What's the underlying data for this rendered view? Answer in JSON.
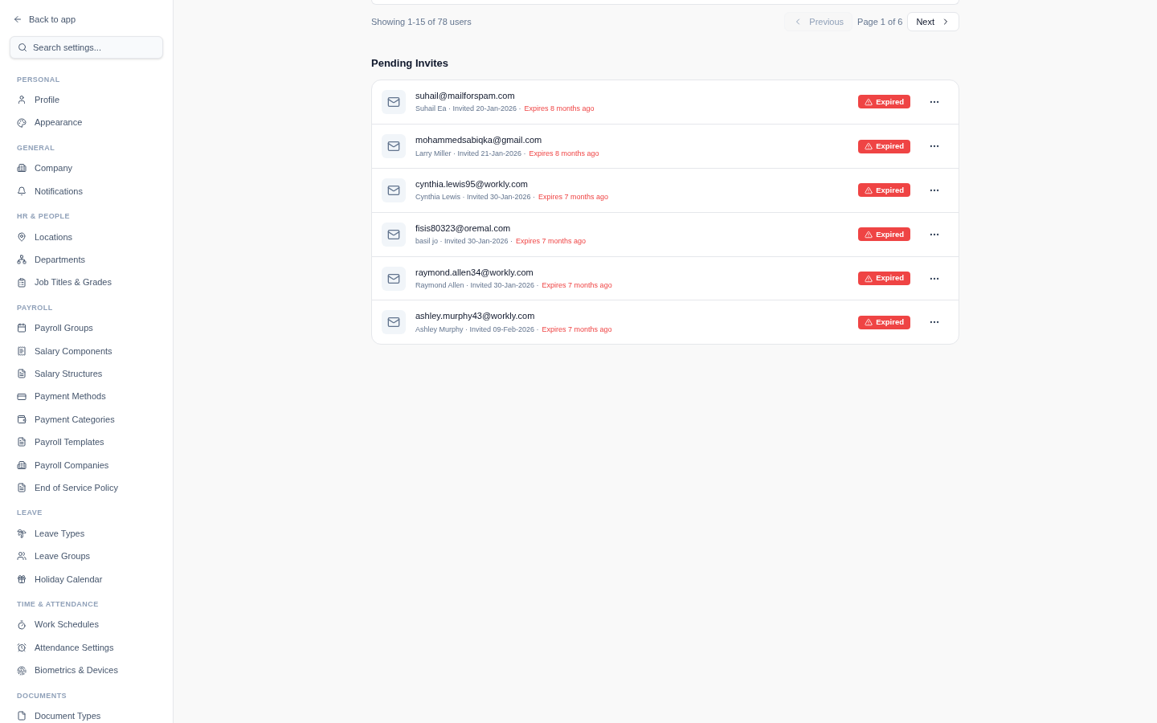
{
  "sidebar": {
    "back_link": "Back to app",
    "search": {
      "placeholder": "Search settings..."
    },
    "sections": [
      {
        "title": "PERSONAL",
        "items": [
          {
            "label": "Profile"
          },
          {
            "label": "Appearance"
          }
        ]
      },
      {
        "title": "GENERAL",
        "items": [
          {
            "label": "Company"
          },
          {
            "label": "Notifications"
          }
        ]
      },
      {
        "title": "HR & PEOPLE",
        "items": [
          {
            "label": "Locations"
          },
          {
            "label": "Departments"
          },
          {
            "label": "Job Titles & Grades"
          }
        ]
      },
      {
        "title": "PAYROLL",
        "items": [
          {
            "label": "Payroll Groups"
          },
          {
            "label": "Salary Components"
          },
          {
            "label": "Salary Structures"
          },
          {
            "label": "Payment Methods"
          },
          {
            "label": "Payment Categories"
          },
          {
            "label": "Payroll Templates"
          },
          {
            "label": "Payroll Companies"
          },
          {
            "label": "End of Service Policy"
          }
        ]
      },
      {
        "title": "LEAVE",
        "items": [
          {
            "label": "Leave Types"
          },
          {
            "label": "Leave Groups"
          },
          {
            "label": "Holiday Calendar"
          }
        ]
      },
      {
        "title": "TIME & ATTENDANCE",
        "items": [
          {
            "label": "Work Schedules"
          },
          {
            "label": "Attendance Settings"
          },
          {
            "label": "Biometrics & Devices"
          }
        ]
      },
      {
        "title": "DOCUMENTS",
        "items": [
          {
            "label": "Document Types"
          }
        ]
      }
    ]
  },
  "pagination": {
    "summary": "Showing 1-15 of 78 users",
    "previous": {
      "label": "Previous",
      "disabled": true
    },
    "page": "Page 1 of 6",
    "next": {
      "label": "Next",
      "disabled": false
    }
  },
  "pending_invites": {
    "title": "Pending Invites",
    "invites": [
      {
        "email": "suhail@mailforspam.com",
        "meta": "Suhail Ea · Invited 20-Jan-2026 ·",
        "expires": "Expires 8 months ago",
        "status": "Expired",
        "kind": "expired"
      },
      {
        "email": "mohammedsabiqka@gmail.com",
        "meta": "Larry Miller · Invited 21-Jan-2026 ·",
        "expires": "Expires 8 months ago",
        "status": "Expired",
        "kind": "expired"
      },
      {
        "email": "cynthia.lewis95@workly.com",
        "meta": "Cynthia Lewis · Invited 30-Jan-2026 ·",
        "expires": "Expires 7 months ago",
        "status": "Expired",
        "kind": "expired"
      },
      {
        "email": "fisis80323@oremal.com",
        "meta": "basil jo · Invited 30-Jan-2026 ·",
        "expires": "Expires 7 months ago",
        "status": "Expired",
        "kind": "expired"
      },
      {
        "email": "raymond.allen34@workly.com",
        "meta": "Raymond Allen · Invited 30-Jan-2026 ·",
        "expires": "Expires 7 months ago",
        "status": "Expired",
        "kind": "expired"
      },
      {
        "email": "ashley.murphy43@workly.com",
        "meta": "Ashley Murphy · Invited 09-Feb-2026 ·",
        "expires": "Expires 7 months ago",
        "status": "Expired",
        "kind": "expired"
      }
    ]
  }
}
